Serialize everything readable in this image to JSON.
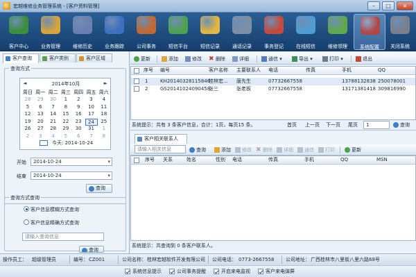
{
  "window": {
    "title": "宏越维修业务管理系统 - [客户资料管理]",
    "btn_min": "–",
    "btn_max": "□",
    "btn_close": "×"
  },
  "toolbar": {
    "items": [
      {
        "label": "客户中心",
        "icon": "customer-center-icon",
        "color": "#3b8f3a"
      },
      {
        "label": "业务管理",
        "icon": "business-icon",
        "color": "#d9a43a"
      },
      {
        "label": "维修历史",
        "icon": "history-icon",
        "color": "#6b7fb2"
      },
      {
        "label": "业务跟踪",
        "icon": "tracking-icon",
        "color": "#3d6fc2"
      },
      {
        "label": "公司事务",
        "icon": "affairs-icon",
        "color": "#c4682f"
      },
      {
        "label": "短信平台",
        "icon": "sms-icon",
        "color": "#4ea24e"
      },
      {
        "label": "短信记录",
        "icon": "sms-record-icon",
        "color": "#e3b640"
      },
      {
        "label": "通话记录",
        "icon": "phone-icon",
        "color": "#7d8fa6"
      },
      {
        "label": "事务登记",
        "icon": "register-icon",
        "color": "#c64a3c"
      },
      {
        "label": "在线短信",
        "icon": "online-sms-icon",
        "color": "#4e9ed4"
      },
      {
        "label": "维修领理",
        "icon": "repair-icon",
        "color": "#61a84a"
      },
      {
        "label": "系统配置",
        "icon": "config-icon",
        "color": "#b04848"
      },
      {
        "label": "关闭系统",
        "icon": "close-system-icon",
        "color": "#7b7f8a"
      }
    ]
  },
  "left": {
    "tabs": [
      "客户查询",
      "客户类别",
      "客户区域"
    ],
    "query_group": "查询方式",
    "calendar": {
      "header": "2014年10月",
      "prev": "◄",
      "next": "►",
      "weekdays": [
        "周日",
        "周一",
        "周二",
        "周三",
        "周四",
        "周五",
        "周六"
      ],
      "rows": [
        [
          "28",
          "29",
          "30",
          "1",
          "2",
          "3",
          "4"
        ],
        [
          "5",
          "6",
          "7",
          "8",
          "9",
          "10",
          "11"
        ],
        [
          "12",
          "13",
          "14",
          "15",
          "16",
          "17",
          "18"
        ],
        [
          "19",
          "20",
          "21",
          "22",
          "23",
          "24",
          "25"
        ],
        [
          "26",
          "27",
          "28",
          "29",
          "30",
          "31",
          "1"
        ],
        [
          "2",
          "3",
          "4",
          "5",
          "6",
          "7",
          "8"
        ]
      ],
      "today": "今天: 2014-10-24"
    },
    "start_label": "开始",
    "start_value": "2014-10-24",
    "end_label": "结束",
    "end_value": "2014-10-24",
    "search_btn": "查询",
    "query_group2": "查询方式查询",
    "radio1": "客户信息模糊方式查询",
    "radio2": "客户信息精确方式查询",
    "input_placeholder": "请输入查询信息",
    "search_btn2": "查询"
  },
  "main": {
    "tb": [
      "更新",
      "添加",
      "修改",
      "删除",
      "详细",
      "通信",
      "导出",
      "打印",
      "退出"
    ],
    "columns": [
      "序号",
      "编号",
      "客户名称",
      "主要联系人",
      "电话",
      "传真",
      "手机",
      "QQ"
    ],
    "rows": [
      {
        "no": "1",
        "code": "KH20140328115846",
        "name": "桂林宏...",
        "contact": "唐先生",
        "phone": "07732667558",
        "fax": "",
        "mobile": "13788132838",
        "qq": "250078001"
      },
      {
        "no": "2",
        "code": "GS20141024090458",
        "name": "张三",
        "contact": "张老板",
        "phone": "07732667558",
        "fax": "",
        "mobile": "13171381418",
        "qq": "309816990"
      }
    ],
    "hint": "系统提示：共有 3 条客户信息，合计：1页，每页15 条。",
    "pager": {
      "first": "首页",
      "prev": "上一页",
      "next": "下一页",
      "last": "尾页",
      "page": "1",
      "go": "查询"
    },
    "sub_tab": "客户相关联系人",
    "sub_input": "请输入相关信息",
    "sub_tb": [
      "查询",
      "添加",
      "修改",
      "删除",
      "详细",
      "通信",
      "打印",
      "更新"
    ],
    "sub_columns": [
      "序号",
      "关系",
      "姓名",
      "性别",
      "电话",
      "传真",
      "手机",
      "QQ",
      "MSN"
    ],
    "sub_hint": "系统提示：共查询到 0 条客户联系人。"
  },
  "status": {
    "operator_label": "操作员工：",
    "operator": "超级管理员",
    "number_label": "编号：",
    "number": "CZ001",
    "company_label": "公司名称：",
    "company": "桂林宏越软件开发有限公司",
    "tel_label": "公司电话：",
    "tel": "0773-2667558",
    "addr_label": "公司地址：",
    "addr": "广西桂林市八里街八里六路68号"
  },
  "status2": {
    "c1": "系统信息提示",
    "c2": "公司事务提醒",
    "c3": "开启来电监视",
    "c4": "客户来电弹屏"
  }
}
